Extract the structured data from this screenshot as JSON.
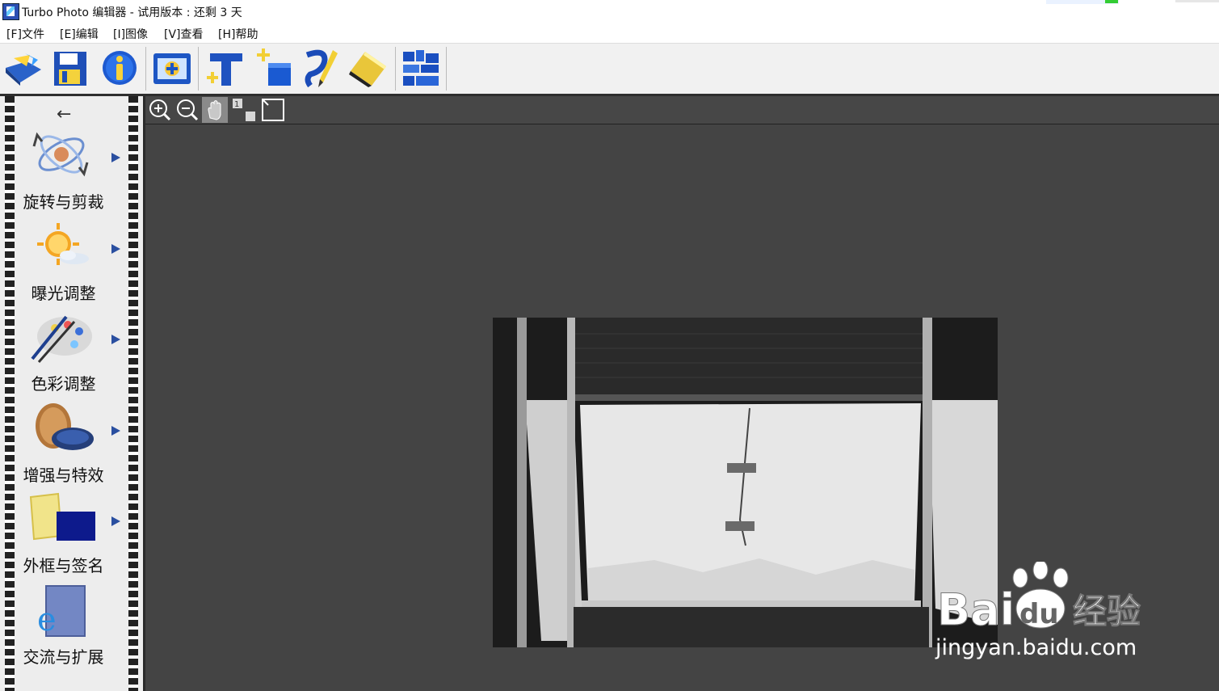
{
  "window": {
    "title": "Turbo Photo 编辑器  - 试用版本 : 还剩 3 天"
  },
  "menu": [
    {
      "label": "[F]文件"
    },
    {
      "label": "[E]编辑"
    },
    {
      "label": "[I]图像"
    },
    {
      "label": "[V]查看"
    },
    {
      "label": "[H]帮助"
    }
  ],
  "toolbar": {
    "buttons": [
      {
        "icon": "open-folder-icon"
      },
      {
        "icon": "save-icon"
      },
      {
        "icon": "info-icon"
      },
      {
        "icon": "add-photo-icon"
      },
      {
        "icon": "add-text-icon"
      },
      {
        "icon": "add-shape-icon"
      },
      {
        "icon": "brush-icon"
      },
      {
        "icon": "eraser-icon"
      },
      {
        "icon": "layout-grid-icon"
      }
    ]
  },
  "sidebar": {
    "items": [
      {
        "label": "旋转与剪裁",
        "icon": "rotate-crop-icon"
      },
      {
        "label": "曝光调整",
        "icon": "exposure-sun-icon"
      },
      {
        "label": "色彩调整",
        "icon": "color-palette-icon"
      },
      {
        "label": "增强与特效",
        "icon": "lens-filter-icon"
      },
      {
        "label": "外框与签名",
        "icon": "frame-signature-icon"
      },
      {
        "label": "交流与扩展",
        "icon": "share-extend-icon"
      }
    ]
  },
  "viewbar": {
    "buttons": [
      {
        "icon": "zoom-in-icon"
      },
      {
        "icon": "zoom-out-icon"
      },
      {
        "icon": "pan-hand-icon"
      },
      {
        "icon": "actual-size-icon",
        "text": "1"
      },
      {
        "icon": "fit-window-icon"
      }
    ]
  },
  "watermark": {
    "brand": "Bai",
    "brand_cn": "经验",
    "url": "jingyan.baidu.com"
  },
  "colors": {
    "canvas": "#444444",
    "accent": "#2b4fb3"
  }
}
